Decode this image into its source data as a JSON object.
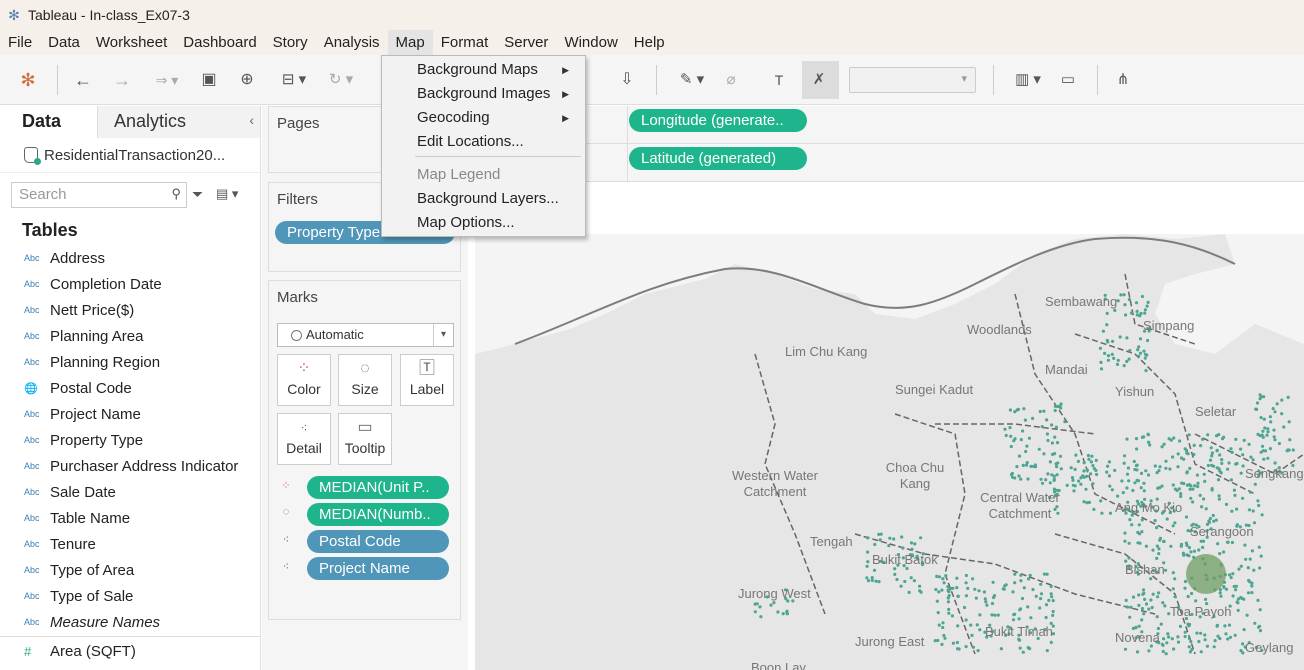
{
  "window": {
    "title": "Tableau - In-class_Ex07-3"
  },
  "menubar": [
    "File",
    "Data",
    "Worksheet",
    "Dashboard",
    "Story",
    "Analysis",
    "Map",
    "Format",
    "Server",
    "Window",
    "Help"
  ],
  "map_menu": {
    "items": [
      "Background Maps",
      "Background Images",
      "Geocoding",
      "Edit Locations..."
    ],
    "items2": [
      "Map Legend",
      "Background Layers...",
      "Map Options..."
    ]
  },
  "data_pane": {
    "tab_data": "Data",
    "tab_analytics": "Analytics",
    "datasource": "ResidentialTransaction20...",
    "search_placeholder": "Search",
    "tables_heading": "Tables",
    "fields": [
      {
        "type": "Abc",
        "name": "Address"
      },
      {
        "type": "Abc",
        "name": "Completion Date"
      },
      {
        "type": "Abc",
        "name": "Nett Price($)"
      },
      {
        "type": "Abc",
        "name": "Planning Area"
      },
      {
        "type": "Abc",
        "name": "Planning Region"
      },
      {
        "type": "globe",
        "name": "Postal Code"
      },
      {
        "type": "Abc",
        "name": "Project Name"
      },
      {
        "type": "Abc",
        "name": "Property Type"
      },
      {
        "type": "Abc",
        "name": "Purchaser Address Indicator"
      },
      {
        "type": "Abc",
        "name": "Sale Date"
      },
      {
        "type": "Abc",
        "name": "Table Name"
      },
      {
        "type": "Abc",
        "name": "Tenure"
      },
      {
        "type": "Abc",
        "name": "Type of Area"
      },
      {
        "type": "Abc",
        "name": "Type of Sale"
      },
      {
        "type": "Abc",
        "name": "Measure Names"
      }
    ],
    "measure": {
      "type": "#",
      "name": "Area (SQFT)"
    }
  },
  "shelves": {
    "pages_title": "Pages",
    "filters_title": "Filters",
    "filter_pill": "Property Type",
    "marks_title": "Marks",
    "mark_type": "Automatic",
    "buttons": {
      "color": "Color",
      "size": "Size",
      "label": "Label",
      "detail": "Detail",
      "tooltip": "Tooltip"
    },
    "mark_pills": [
      "MEDIAN(Unit P..",
      "MEDIAN(Numb..",
      "Postal Code",
      "Project Name"
    ],
    "columns_pill": "Longitude (generate..",
    "rows_pill": "Latitude (generated)"
  },
  "map": {
    "labels": [
      "Sembawang",
      "Simpang",
      "Woodlands",
      "Lim Chu Kang",
      "Mandai",
      "Yishun",
      "Sungei Kadut",
      "Seletar",
      "Western Water Catchment",
      "Choa Chu Kang",
      "Sengkang",
      "Central Water Catchment",
      "Ang Mo Kio",
      "Serangoon",
      "Tengah",
      "Bukit Batok",
      "Bishan",
      "Jurong West",
      "Toa Payoh",
      "Jurong East",
      "Bukit Timah",
      "Novena",
      "Geylang",
      "Boon Lay"
    ],
    "point_color": "#4ea593"
  }
}
